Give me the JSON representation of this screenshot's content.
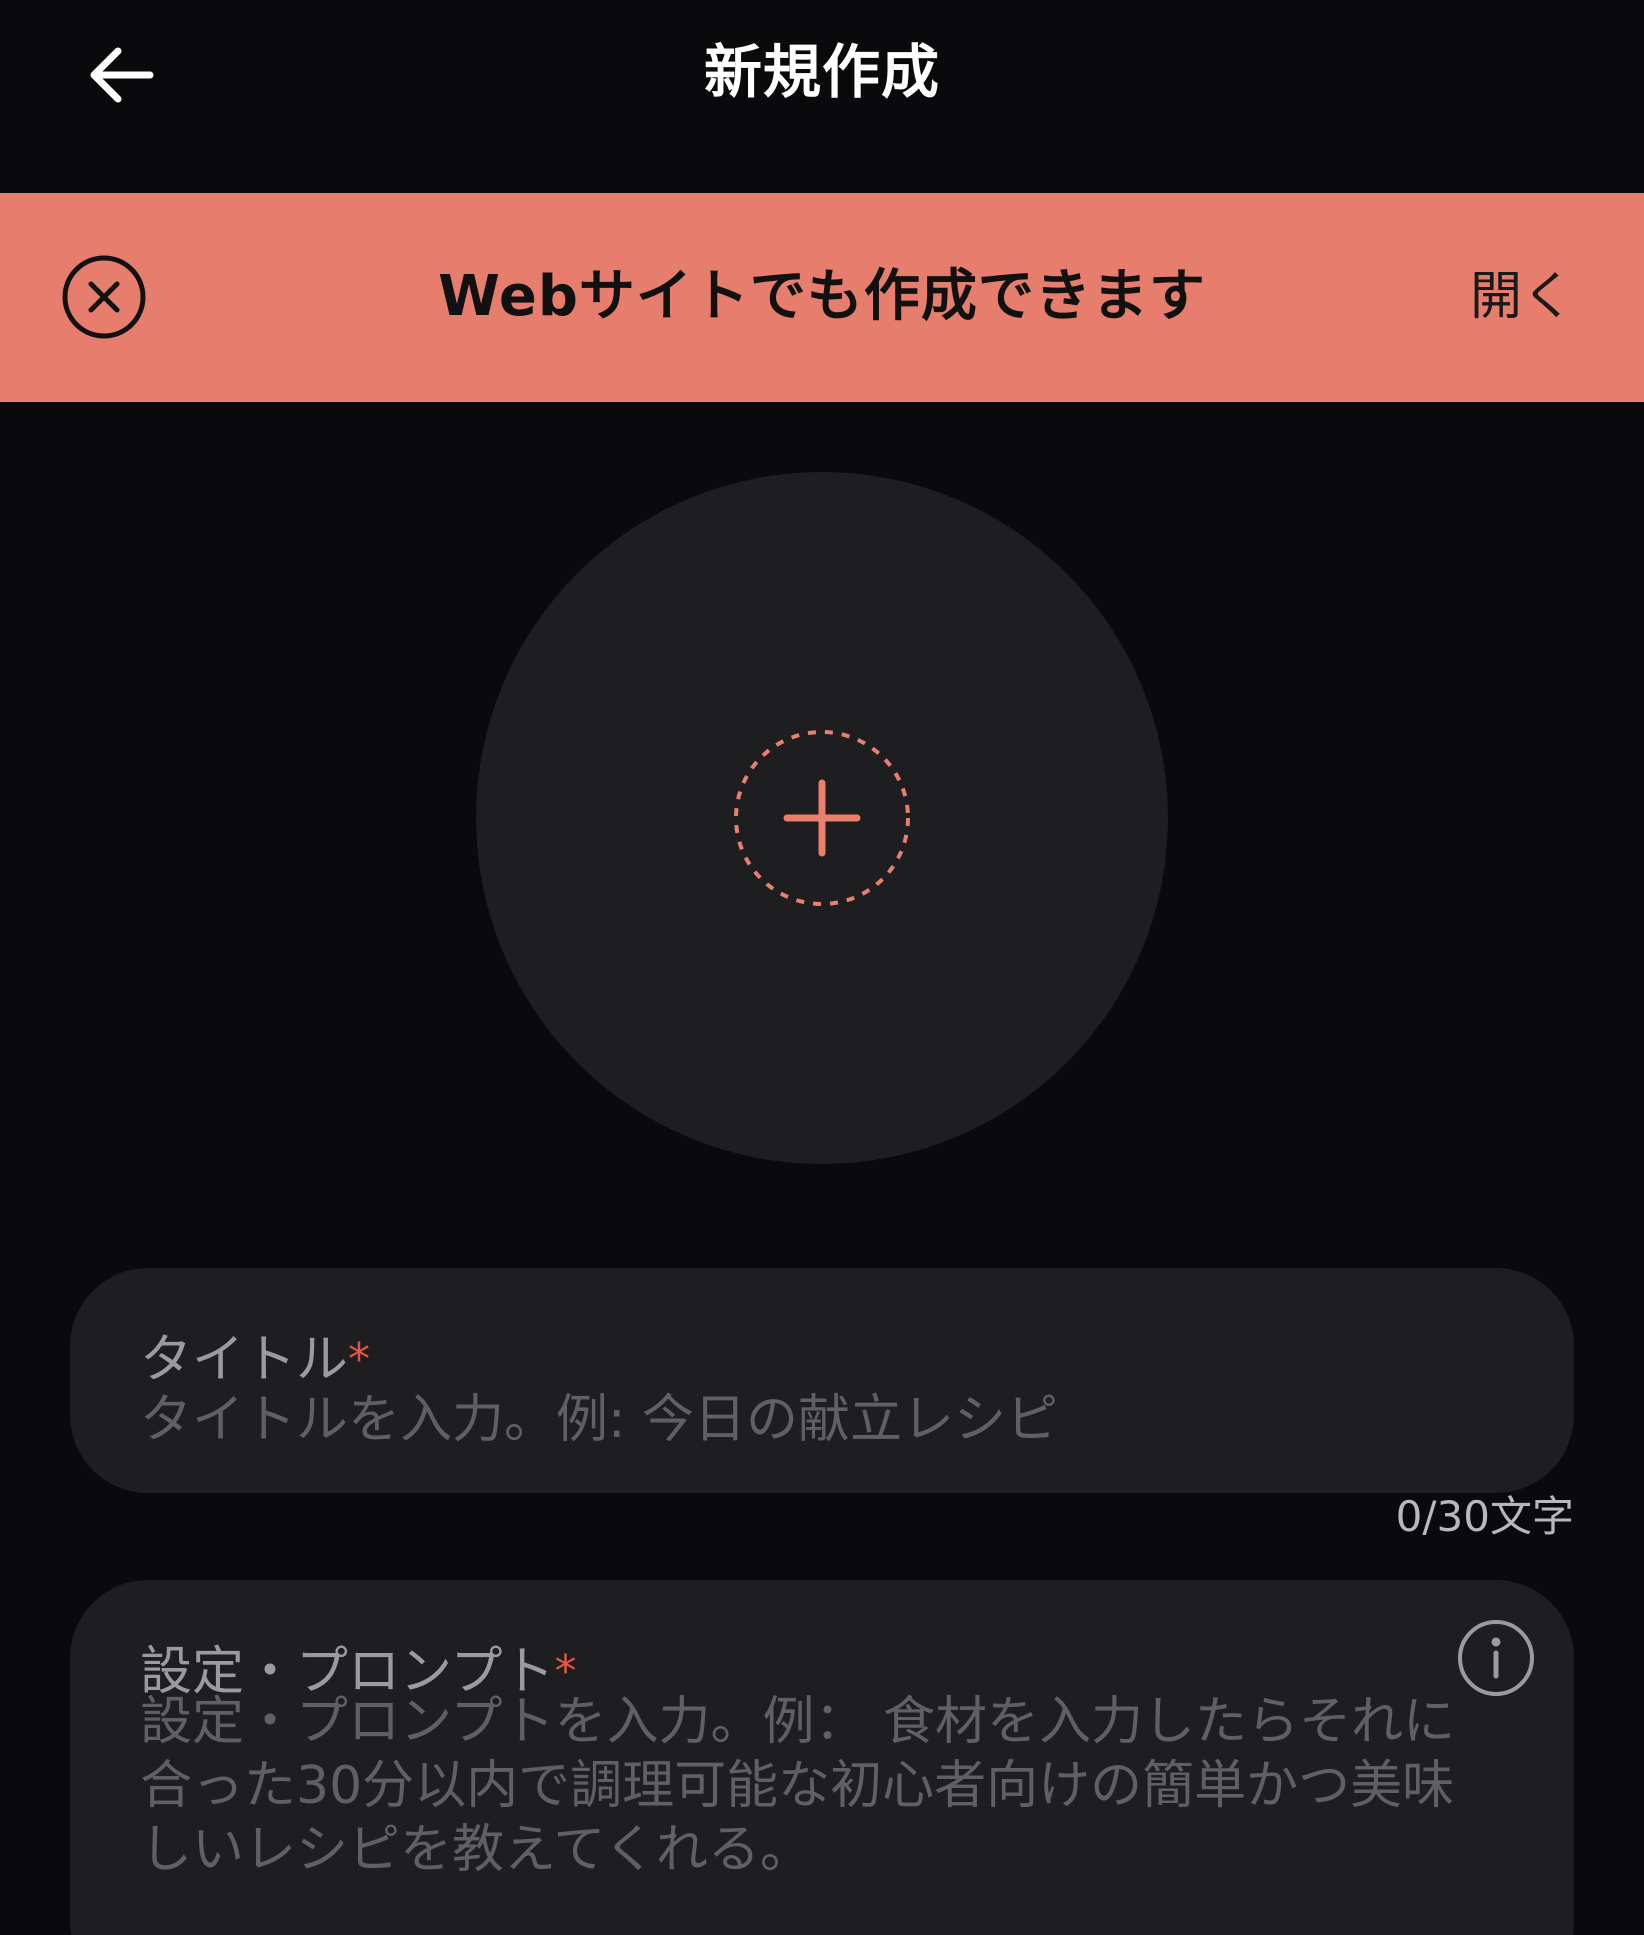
{
  "header": {
    "title": "新規作成",
    "back_icon": "arrow-left-icon"
  },
  "banner": {
    "text": "Webサイトでも作成できます",
    "open_label": "開く",
    "close_icon": "circle-close-icon",
    "background_color": "#e77e6d"
  },
  "image_picker": {
    "icon": "add-image-icon",
    "accent_color": "#e9806e"
  },
  "title_field": {
    "label": "タイトル",
    "required_mark": "*",
    "placeholder": "タイトルを入力。例: 今日の献立レシピ",
    "value": "",
    "char_count": "0/30文字"
  },
  "prompt_field": {
    "label": "設定・プロンプト",
    "required_mark": "*",
    "placeholder": "設定・プロンプトを入力。例： 食材を入力したらそれに合った30分以内で調理可能な初心者向けの簡単かつ美味しいレシピを教えてくれる。",
    "value": "",
    "info_icon": "info-icon"
  }
}
